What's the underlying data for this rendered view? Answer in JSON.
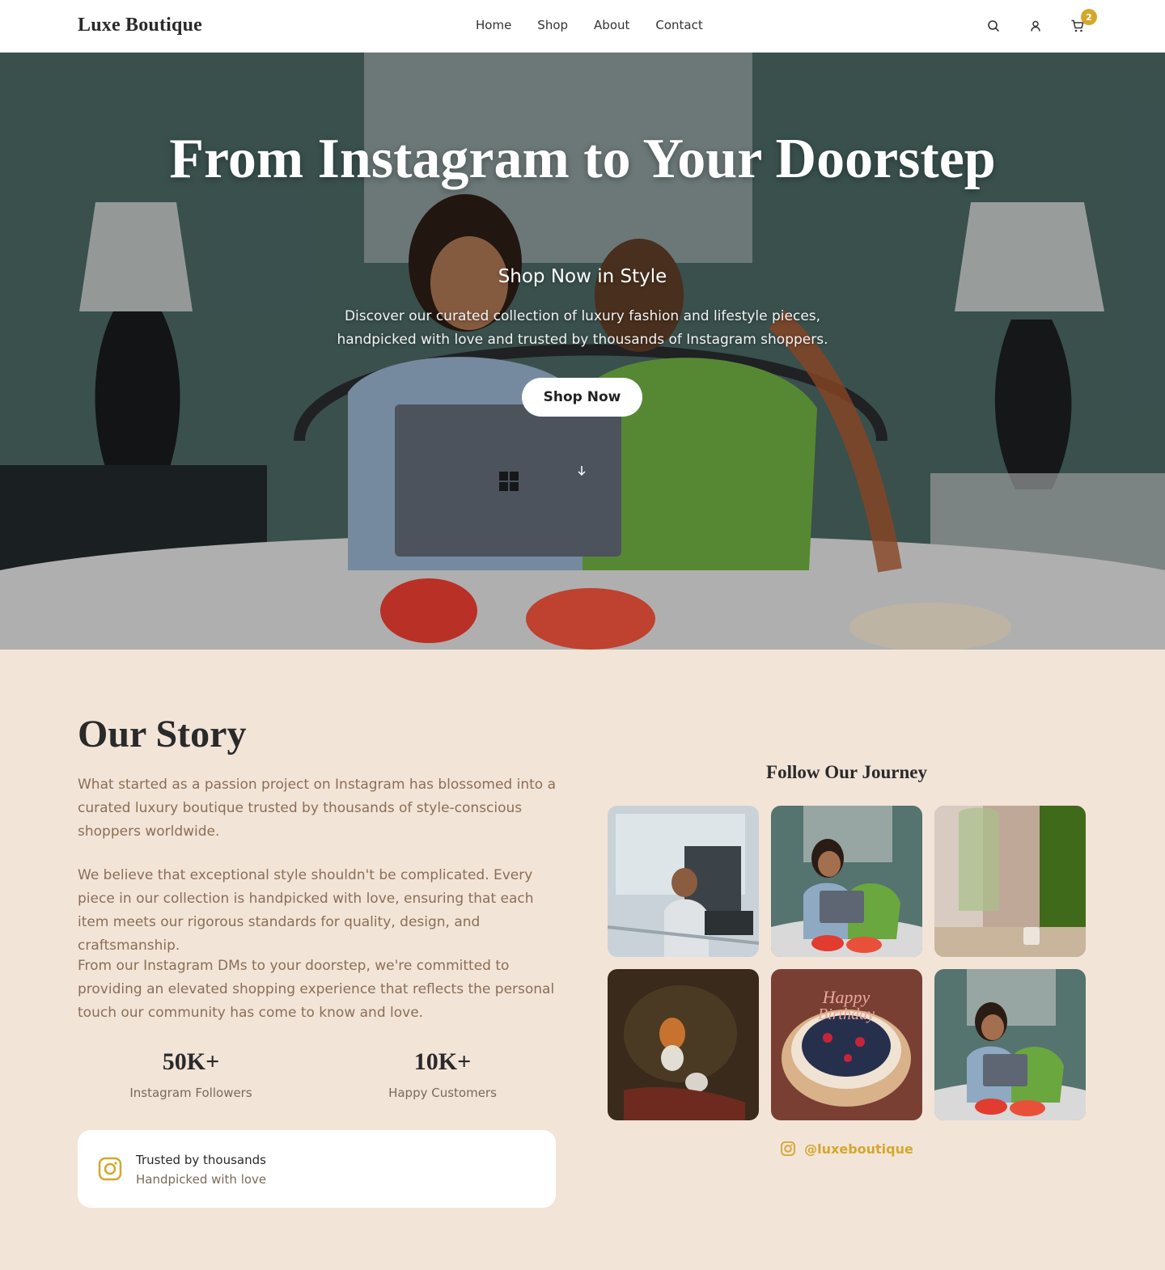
{
  "header": {
    "logo": "Luxe Boutique",
    "nav": [
      "Home",
      "Shop",
      "About",
      "Contact"
    ],
    "icons": [
      "search-icon",
      "user-icon",
      "cart-icon"
    ],
    "cart_count": "2"
  },
  "hero": {
    "title": "From Instagram to Your Doorstep",
    "subtitle": "Shop Now in Style",
    "description": "Discover our curated collection of luxury fashion and lifestyle pieces, handpicked with love and trusted by thousands of Instagram shoppers.",
    "cta_label": "Shop Now"
  },
  "story": {
    "title": "Our Story",
    "paragraphs": [
      "What started as a passion project on Instagram has blossomed into a curated luxury boutique trusted by thousands of style-conscious shoppers worldwide.",
      "We believe that exceptional style shouldn't be complicated. Every piece in our collection is handpicked with love, ensuring that each item meets our rigorous standards for quality, design, and craftsmanship.",
      "From our Instagram DMs to your doorstep, we're committed to providing an elevated shopping experience that reflects the personal touch our community has come to know and love."
    ],
    "stats": [
      {
        "value": "50K+",
        "label": "Instagram Followers"
      },
      {
        "value": "10K+",
        "label": "Happy Customers"
      }
    ],
    "trust": {
      "title": "Trusted by thousands",
      "subtitle": "Handpicked with love"
    }
  },
  "journey": {
    "title": "Follow Our Journey",
    "handle": "@luxeboutique"
  },
  "colors": {
    "accent": "#d4a72c",
    "section_bg": "#f3e4d8",
    "body_text": "#8a6f55"
  }
}
